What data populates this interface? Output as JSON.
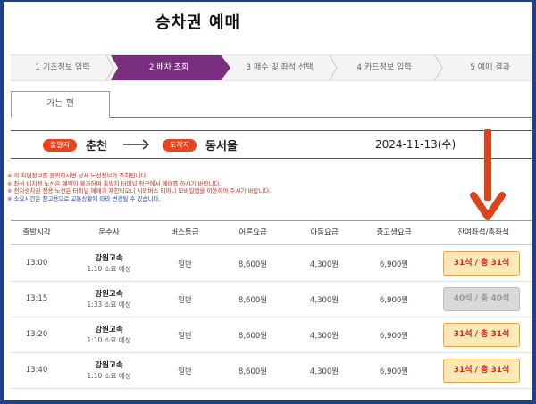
{
  "page": {
    "title": "승차권 예매"
  },
  "steps": [
    {
      "label": "1 기초정보 입력",
      "active": false
    },
    {
      "label": "2 배차 조회",
      "active": true
    },
    {
      "label": "3 매수 및 좌석 선택",
      "active": false
    },
    {
      "label": "4 카드정보 입력",
      "active": false
    },
    {
      "label": "5 예매 결과",
      "active": false
    }
  ],
  "tabs": [
    {
      "label": "가는 편"
    }
  ],
  "route": {
    "departure_badge": "출발지",
    "departure": "춘천",
    "arrival_badge": "도착지",
    "arrival": "동서울",
    "date": "2024-11-13(수)"
  },
  "notices": [
    {
      "text": "※ 각 차편정보를 클릭하시면 상세 노선정보가 조회됩니다.",
      "color": "red"
    },
    {
      "text": "※ 좌석 비지정 노선은 예약이 불가하며 출발지 터미널 창구에서 예매를 하시기 바랍니다.",
      "color": "red"
    },
    {
      "text": "※ 전자승차권 전용 노선은 터미널 예매가 제한되오니 시외버스 티머니 모바일앱을 이용하여 주시기 바랍니다.",
      "color": "red"
    },
    {
      "text": "※ 소요시간은 참고용으로 교통상황에 따라 변경될 수 있습니다.",
      "color": "blue"
    }
  ],
  "table": {
    "headers": [
      "출발시각",
      "운수사",
      "버스등급",
      "어른요금",
      "아동요금",
      "중고생요금",
      "잔여좌석/총좌석"
    ],
    "rows": [
      {
        "time": "13:00",
        "company": "강원고속",
        "duration": "1:10 소요 예상",
        "grade": "일반",
        "adult": "8,600원",
        "child": "4,300원",
        "teen": "6,900원",
        "seats": "31석 / 총 31석",
        "available": true
      },
      {
        "time": "13:15",
        "company": "강원고속",
        "duration": "1:33 소요 예상",
        "grade": "일반",
        "adult": "8,600원",
        "child": "4,300원",
        "teen": "6,900원",
        "seats": "40석 / 총 40석",
        "available": false
      },
      {
        "time": "13:20",
        "company": "강원고속",
        "duration": "1:10 소요 예상",
        "grade": "일반",
        "adult": "8,600원",
        "child": "4,300원",
        "teen": "6,900원",
        "seats": "31석 / 총 31석",
        "available": true
      },
      {
        "time": "13:40",
        "company": "강원고속",
        "duration": "1:10 소요 예상",
        "grade": "일반",
        "adult": "8,600원",
        "child": "4,300원",
        "teen": "6,900원",
        "seats": "31석 / 총 31석",
        "available": true
      }
    ]
  },
  "colors": {
    "frame_border": "#1f3f8f",
    "step_active": "#7a2e7f",
    "badge": "#e8451e",
    "seat_available_bg": "#fde9b5",
    "seat_available_text": "#d42a1a",
    "seat_disabled_bg": "#d9d9d9",
    "annotation_arrow": "#d9441c"
  },
  "icons": {
    "route_arrow": "right-arrow-icon",
    "annotation": "down-arrow-icon"
  }
}
